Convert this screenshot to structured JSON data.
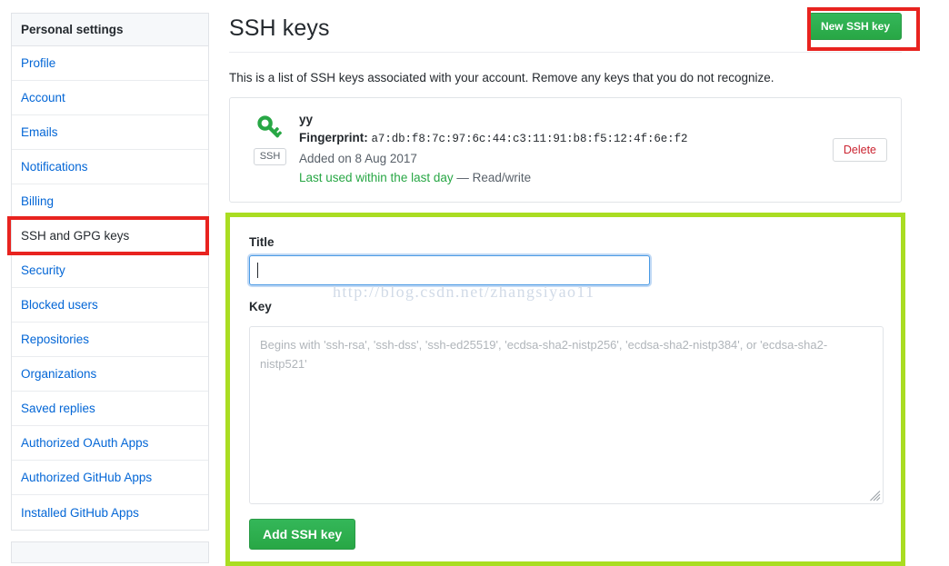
{
  "sidebar": {
    "header": "Personal settings",
    "items": [
      {
        "label": "Profile",
        "selected": false
      },
      {
        "label": "Account",
        "selected": false
      },
      {
        "label": "Emails",
        "selected": false
      },
      {
        "label": "Notifications",
        "selected": false
      },
      {
        "label": "Billing",
        "selected": false
      },
      {
        "label": "SSH and GPG keys",
        "selected": true
      },
      {
        "label": "Security",
        "selected": false
      },
      {
        "label": "Blocked users",
        "selected": false
      },
      {
        "label": "Repositories",
        "selected": false
      },
      {
        "label": "Organizations",
        "selected": false
      },
      {
        "label": "Saved replies",
        "selected": false
      },
      {
        "label": "Authorized OAuth Apps",
        "selected": false
      },
      {
        "label": "Authorized GitHub Apps",
        "selected": false
      },
      {
        "label": "Installed GitHub Apps",
        "selected": false
      }
    ]
  },
  "page": {
    "title": "SSH keys",
    "new_key_button": "New SSH key",
    "description": "This is a list of SSH keys associated with your account. Remove any keys that you do not recognize."
  },
  "key_card": {
    "icon": "key-icon",
    "badge": "SSH",
    "name": "yy",
    "fingerprint_label": "Fingerprint:",
    "fingerprint": "a7:db:f8:7c:97:6c:44:c3:11:91:b8:f5:12:4f:6e:f2",
    "added": "Added on 8 Aug 2017",
    "last_used": "Last used within the last day",
    "access": "— Read/write",
    "delete_button": "Delete"
  },
  "form": {
    "title_label": "Title",
    "title_value": "",
    "title_placeholder": "",
    "key_label": "Key",
    "key_value": "",
    "key_placeholder": "Begins with 'ssh-rsa', 'ssh-dss', 'ssh-ed25519', 'ecdsa-sha2-nistp256', 'ecdsa-sha2-nistp384', or 'ecdsa-sha2-nistp521'",
    "submit_button": "Add SSH key"
  },
  "watermark": "http://blog.csdn.net/zhangsiyao11",
  "annotations": {
    "red_box_color": "#e8231f",
    "green_box_color": "#aadd22"
  },
  "colors": {
    "accent_green": "#28a745",
    "link_blue": "#0366d6",
    "danger_red": "#cb2431",
    "border_grey": "#e1e4e8"
  }
}
